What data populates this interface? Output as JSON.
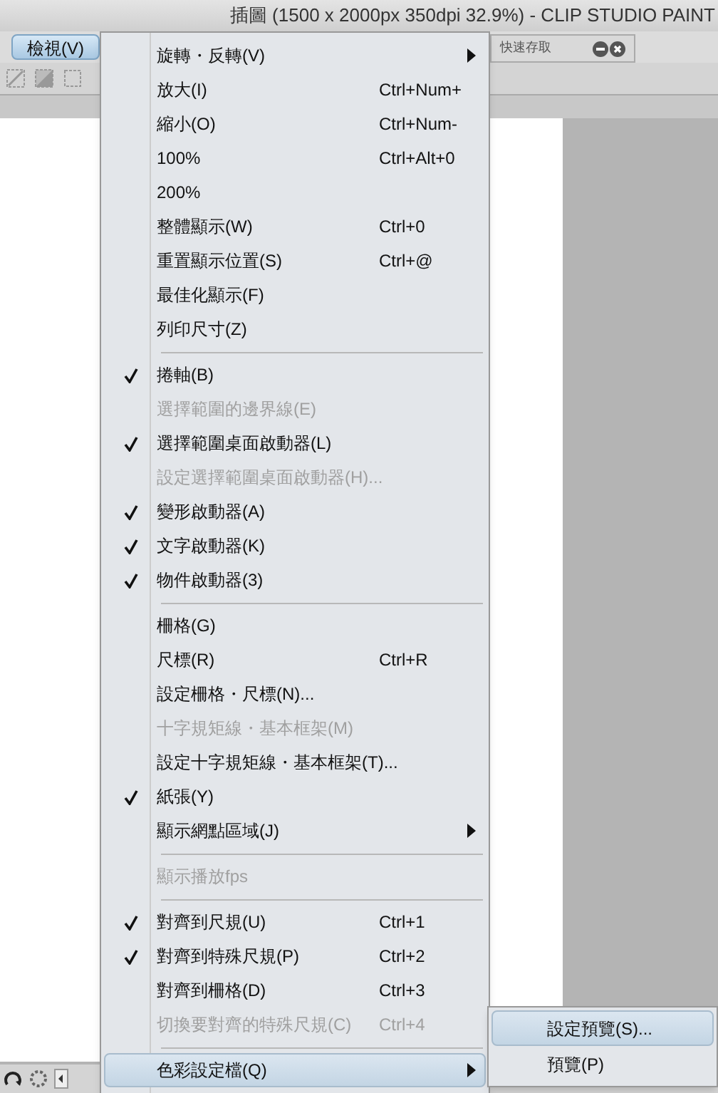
{
  "window": {
    "title": "插圖 (1500 x 2000px 350dpi 32.9%)  - CLIP STUDIO PAINT"
  },
  "menu_bar": {
    "label": "檢視(V)",
    "selected": true
  },
  "panel_tab": {
    "label": "快速存取"
  },
  "menu": [
    {
      "kind": "item",
      "label": "旋轉・反轉(V)",
      "submenu": true,
      "checked": false,
      "disabled": false,
      "selected": false
    },
    {
      "kind": "item",
      "label": "放大(I)",
      "shortcut": "Ctrl+Num+",
      "submenu": false,
      "checked": false,
      "disabled": false,
      "selected": false
    },
    {
      "kind": "item",
      "label": "縮小(O)",
      "shortcut": "Ctrl+Num-",
      "submenu": false,
      "checked": false,
      "disabled": false,
      "selected": false
    },
    {
      "kind": "item",
      "label": "100%",
      "shortcut": "Ctrl+Alt+0",
      "submenu": false,
      "checked": false,
      "disabled": false,
      "selected": false
    },
    {
      "kind": "item",
      "label": "200%",
      "submenu": false,
      "checked": false,
      "disabled": false,
      "selected": false
    },
    {
      "kind": "item",
      "label": "整體顯示(W)",
      "shortcut": "Ctrl+0",
      "submenu": false,
      "checked": false,
      "disabled": false,
      "selected": false
    },
    {
      "kind": "item",
      "label": "重置顯示位置(S)",
      "shortcut": "Ctrl+@",
      "submenu": false,
      "checked": false,
      "disabled": false,
      "selected": false
    },
    {
      "kind": "item",
      "label": "最佳化顯示(F)",
      "submenu": false,
      "checked": false,
      "disabled": false,
      "selected": false
    },
    {
      "kind": "item",
      "label": "列印尺寸(Z)",
      "submenu": false,
      "checked": false,
      "disabled": false,
      "selected": false
    },
    {
      "kind": "separator"
    },
    {
      "kind": "item",
      "label": "捲軸(B)",
      "submenu": false,
      "checked": true,
      "disabled": false,
      "selected": false
    },
    {
      "kind": "item",
      "label": "選擇範圍的邊界線(E)",
      "submenu": false,
      "checked": false,
      "disabled": true,
      "selected": false
    },
    {
      "kind": "item",
      "label": "選擇範圍桌面啟動器(L)",
      "submenu": false,
      "checked": true,
      "disabled": false,
      "selected": false
    },
    {
      "kind": "item",
      "label": "設定選擇範圍桌面啟動器(H)...",
      "submenu": false,
      "checked": false,
      "disabled": true,
      "selected": false
    },
    {
      "kind": "item",
      "label": "變形啟動器(A)",
      "submenu": false,
      "checked": true,
      "disabled": false,
      "selected": false
    },
    {
      "kind": "item",
      "label": "文字啟動器(K)",
      "submenu": false,
      "checked": true,
      "disabled": false,
      "selected": false
    },
    {
      "kind": "item",
      "label": "物件啟動器(3)",
      "submenu": false,
      "checked": true,
      "disabled": false,
      "selected": false
    },
    {
      "kind": "separator"
    },
    {
      "kind": "item",
      "label": "柵格(G)",
      "submenu": false,
      "checked": false,
      "disabled": false,
      "selected": false
    },
    {
      "kind": "item",
      "label": "尺標(R)",
      "shortcut": "Ctrl+R",
      "submenu": false,
      "checked": false,
      "disabled": false,
      "selected": false
    },
    {
      "kind": "item",
      "label": "設定柵格・尺標(N)...",
      "submenu": false,
      "checked": false,
      "disabled": false,
      "selected": false
    },
    {
      "kind": "item",
      "label": "十字規矩線・基本框架(M)",
      "submenu": false,
      "checked": false,
      "disabled": true,
      "selected": false
    },
    {
      "kind": "item",
      "label": "設定十字規矩線・基本框架(T)...",
      "submenu": false,
      "checked": false,
      "disabled": false,
      "selected": false
    },
    {
      "kind": "item",
      "label": "紙張(Y)",
      "submenu": false,
      "checked": true,
      "disabled": false,
      "selected": false
    },
    {
      "kind": "item",
      "label": "顯示網點區域(J)",
      "submenu": true,
      "checked": false,
      "disabled": false,
      "selected": false
    },
    {
      "kind": "separator"
    },
    {
      "kind": "item",
      "label": "顯示播放fps",
      "submenu": false,
      "checked": false,
      "disabled": true,
      "selected": false
    },
    {
      "kind": "separator"
    },
    {
      "kind": "item",
      "label": "對齊到尺規(U)",
      "shortcut": "Ctrl+1",
      "submenu": false,
      "checked": true,
      "disabled": false,
      "selected": false
    },
    {
      "kind": "item",
      "label": "對齊到特殊尺規(P)",
      "shortcut": "Ctrl+2",
      "submenu": false,
      "checked": true,
      "disabled": false,
      "selected": false
    },
    {
      "kind": "item",
      "label": "對齊到柵格(D)",
      "shortcut": "Ctrl+3",
      "submenu": false,
      "checked": false,
      "disabled": false,
      "selected": false
    },
    {
      "kind": "item",
      "label": "切換要對齊的特殊尺規(C)",
      "shortcut": "Ctrl+4",
      "submenu": false,
      "checked": false,
      "disabled": true,
      "selected": false
    },
    {
      "kind": "separator"
    },
    {
      "kind": "item",
      "label": "色彩設定檔(Q)",
      "submenu": true,
      "checked": false,
      "disabled": false,
      "selected": true
    }
  ],
  "submenu": [
    {
      "label": "設定預覽(S)...",
      "selected": true
    },
    {
      "label": "預覽(P)",
      "selected": false
    }
  ]
}
